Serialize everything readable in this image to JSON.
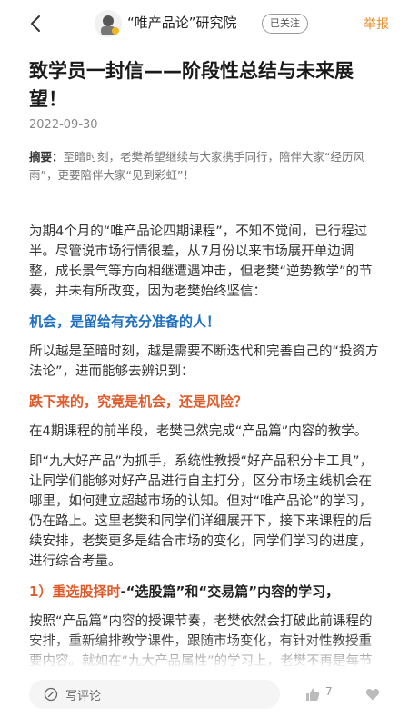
{
  "header": {
    "author_name": "“唯产品论”研究院",
    "follow_label": "已关注",
    "report_label": "举报"
  },
  "article": {
    "title": "致学员一封信——阶段性总结与未来展望！",
    "date": "2022-09-30",
    "abstract_label": "摘要：",
    "abstract_text": "至暗时刻，老樊希望继续与大家携手同行，陪伴大家“经历风雨”，更要陪伴大家“见到彩虹”！",
    "paragraphs": {
      "p1": "为期4个月的“唯产品论四期课程”，不知不觉间，已行程过半。尽管说市场行情很差，从7月份以来市场展开单边调整，成长景气等方向相继遭遇冲击，但老樊“逆势教学”的节奏，并未有所改变，因为老樊始终坚信：",
      "h1": "机会，是留给有充分准备的人！",
      "p2": "所以越是至暗时刻，越是需要不断迭代和完善自己的“投资方法论”，进而能够去辨识到：",
      "h2": "跌下来的，究竟是机会，还是风险？",
      "p3": "在4期课程的前半段，老樊已然完成“产品篇”内容的教学。",
      "p4": "即“九大好产品”为抓手，系统性教授“好产品积分卡工具”，让同学们能够对好产品进行自主打分，区分市场主线机会在哪里，如何建立超越市场的认知。但对“唯产品论”的学习，仍在路上。这里老樊和同学们详细展开下，接下来课程的后续安排，老樊更多是结合市场的变化，同学们学习的进度，进行综合考量。",
      "h3_prefix": "1）",
      "h3_red": "重选股择时",
      "h3_rest": "-“选股篇”和“交易篇”内容的学习，",
      "p5": "按照“产品篇”内容的授课节奏，老樊依然会打破此前课程的安排，重新编排教学课件，跟随市场变化，有针对性教授重要内容。就如在“九大产品属性”的学习上，老樊不再是每节课教授“单一产品属性”，而是产品属性的两两结合，让同学们建立起综合运用的能力。选股篇和"
    }
  },
  "footer": {
    "comment_placeholder": "写评论",
    "like_count": "7"
  },
  "icons": {
    "back": "chevron-left-icon",
    "comment": "pen-icon",
    "like": "thumbs-up-icon",
    "favorite": "heart-icon"
  },
  "colors": {
    "accent_orange": "#e8902b",
    "highlight_blue": "#1f6fc2",
    "highlight_red": "#e05a2a"
  }
}
